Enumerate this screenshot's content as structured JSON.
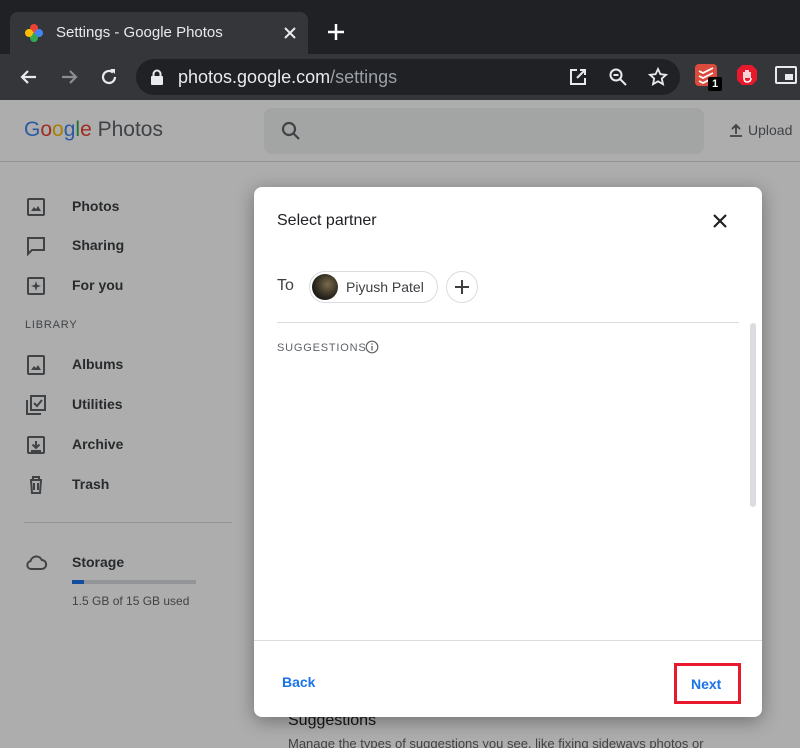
{
  "browser": {
    "tab_title": "Settings - Google Photos",
    "url_host": "photos.google.com",
    "url_path": "/settings",
    "extension_badge": "1"
  },
  "app": {
    "logo_google": "Google",
    "logo_photos": "Photos",
    "upload_label": "Upload"
  },
  "sidebar": {
    "items": [
      {
        "label": "Photos",
        "icon": "photo-icon"
      },
      {
        "label": "Sharing",
        "icon": "chat-bubble-icon"
      },
      {
        "label": "For you",
        "icon": "sparkle-icon"
      }
    ],
    "library_label": "LIBRARY",
    "library_items": [
      {
        "label": "Albums",
        "icon": "album-icon"
      },
      {
        "label": "Utilities",
        "icon": "checklist-icon"
      },
      {
        "label": "Archive",
        "icon": "archive-icon"
      },
      {
        "label": "Trash",
        "icon": "trash-icon"
      }
    ],
    "storage": {
      "label": "Storage",
      "used_text": "1.5 GB of 15 GB used",
      "fraction": 0.1
    }
  },
  "background": {
    "heading": "Suggestions",
    "text": "Manage the types of suggestions you see, like fixing sideways photos or"
  },
  "dialog": {
    "title": "Select partner",
    "to_label": "To",
    "chip_name": "Piyush Patel",
    "suggestions_label": "SUGGESTIONS",
    "back_label": "Back",
    "next_label": "Next"
  },
  "colors": {
    "accent": "#1a73e8",
    "highlight": "#e8192c"
  }
}
